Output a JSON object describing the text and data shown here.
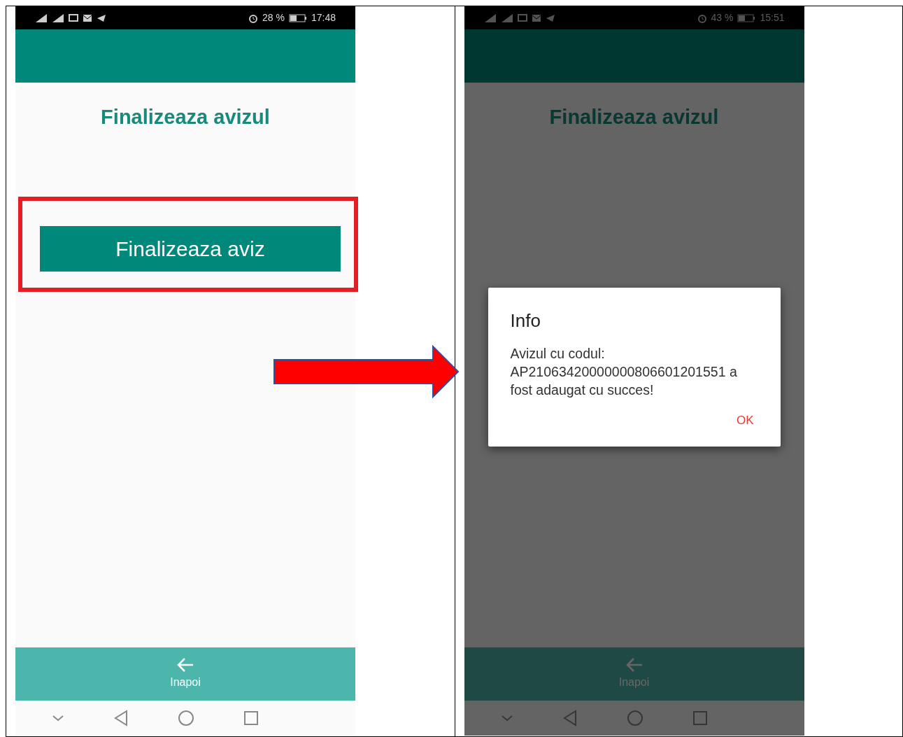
{
  "screens": [
    {
      "status_bar": {
        "battery": "28 %",
        "time": "17:48"
      },
      "dimmed": false,
      "title": "Finalizeaza avizul",
      "action_button": {
        "label": "Finalizeaza aviz",
        "highlighted": true
      },
      "bottom_nav": {
        "label": "Inapoi"
      }
    },
    {
      "status_bar": {
        "battery": "43 %",
        "time": "15:51"
      },
      "dimmed": true,
      "title": "Finalizeaza avizul",
      "dialog": {
        "title": "Info",
        "message": "Avizul cu codul: AP21063420000000806601201551 a fost adaugat cu succes!",
        "button": "OK"
      },
      "bottom_nav": {
        "label": "Inapoi"
      }
    }
  ]
}
